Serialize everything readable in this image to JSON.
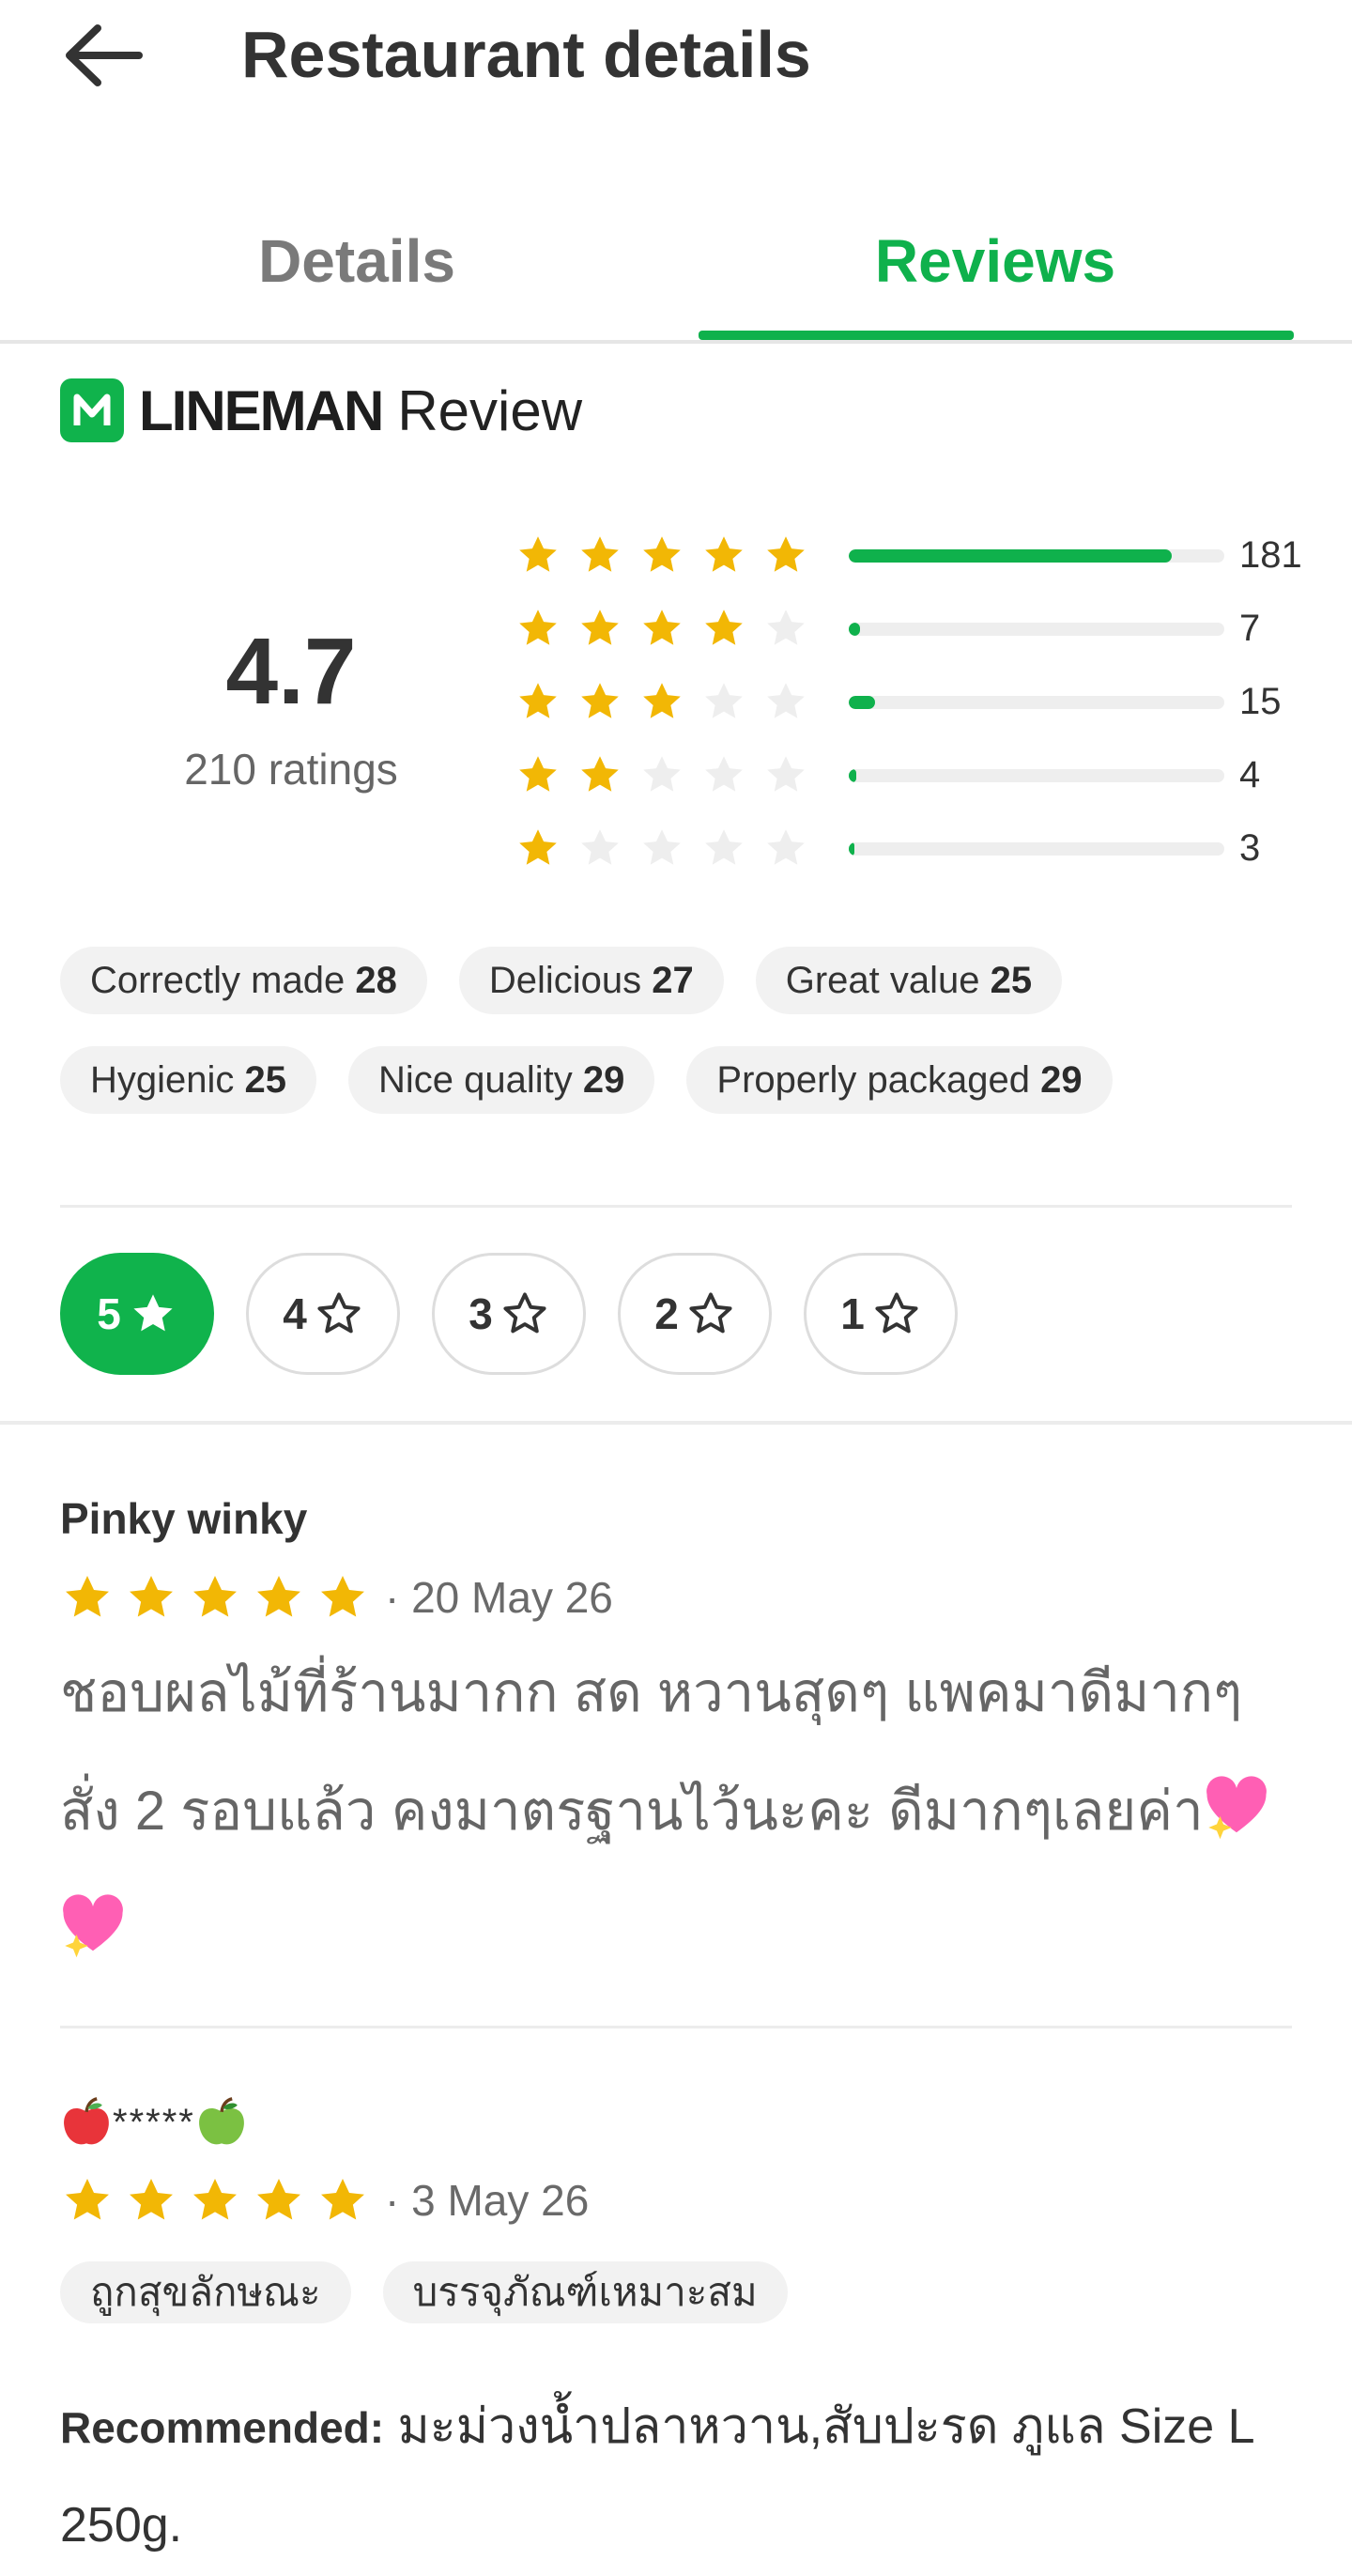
{
  "header": {
    "title": "Restaurant details",
    "back_icon": "arrow-left-icon"
  },
  "tabs": [
    {
      "label": "Details",
      "active": false
    },
    {
      "label": "Reviews",
      "active": true
    }
  ],
  "brand": {
    "name": "LINEMAN",
    "suffix": "Review",
    "color": "#10b34c"
  },
  "summary": {
    "score": "4.7",
    "ratings_label": "210 ratings",
    "distribution": [
      {
        "stars": 5,
        "count": "181",
        "fraction": 0.86
      },
      {
        "stars": 4,
        "count": "7",
        "fraction": 0.03
      },
      {
        "stars": 3,
        "count": "15",
        "fraction": 0.07
      },
      {
        "stars": 2,
        "count": "4",
        "fraction": 0.02
      },
      {
        "stars": 1,
        "count": "3",
        "fraction": 0.015
      }
    ]
  },
  "tags": [
    {
      "label": "Correctly made",
      "count": "28"
    },
    {
      "label": "Delicious",
      "count": "27"
    },
    {
      "label": "Great value",
      "count": "25"
    },
    {
      "label": "Hygienic",
      "count": "25"
    },
    {
      "label": "Nice quality",
      "count": "29"
    },
    {
      "label": "Properly packaged",
      "count": "29"
    }
  ],
  "filter_chips": [
    {
      "label": "5",
      "active": true
    },
    {
      "label": "4",
      "active": false
    },
    {
      "label": "3",
      "active": false
    },
    {
      "label": "2",
      "active": false
    },
    {
      "label": "1",
      "active": false
    }
  ],
  "reviews": [
    {
      "name": "Pinky winky",
      "stars": 5,
      "date": "· 20 May 26",
      "text": "ชอบผลไม้ที่ร้านมากก สด หวานสุดๆ แพคมาดีมากๆ สั่ง 2 รอบแล้ว คงมาตรฐานไว้นะคะ ดีมากๆเลยค่า"
    },
    {
      "name": "*****",
      "stars": 5,
      "date": "· 3 May 26",
      "tags": [
        "ถูกสุขลักษณะ",
        "บรรจุภัณฑ์เหมาะสม"
      ],
      "recommended_label": "Recommended:",
      "recommended_text": "มะม่วงน้ำปลาหวาน,สับปะรด ภูแล Size L 250g."
    }
  ],
  "colors": {
    "accent": "#0fb14c",
    "star": "#f2b705",
    "star_empty": "#eeeeee"
  }
}
